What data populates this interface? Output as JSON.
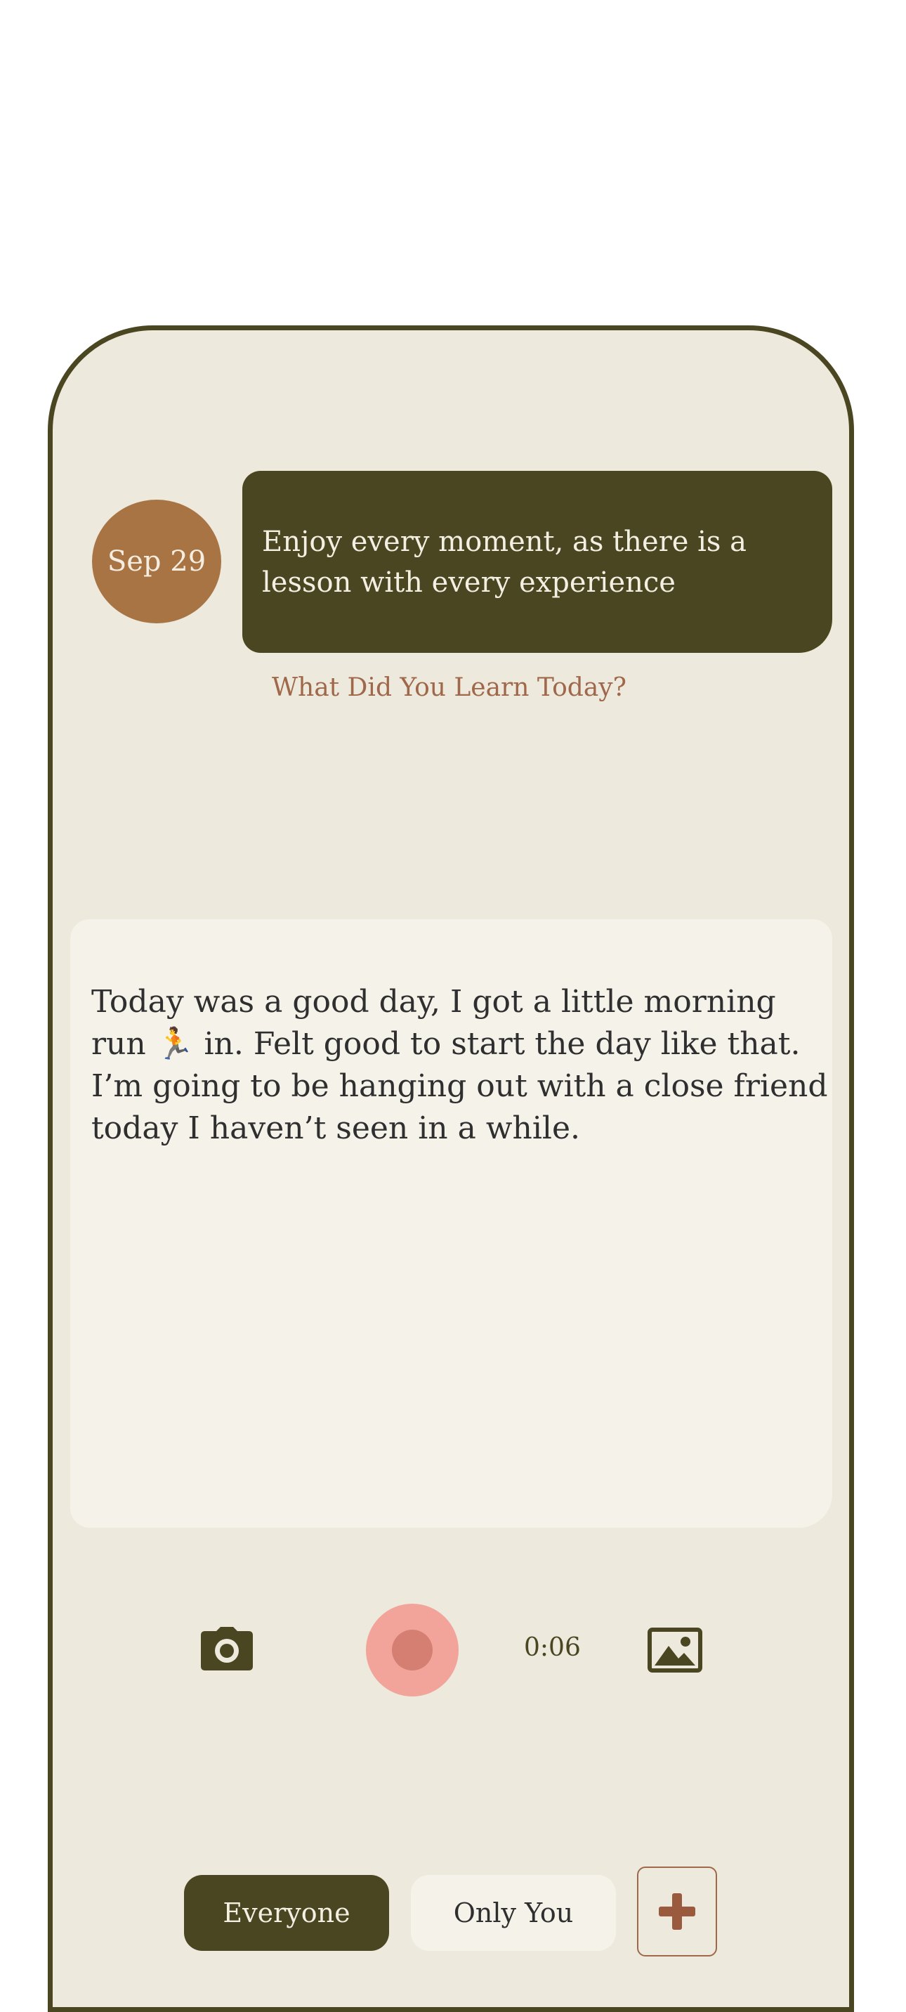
{
  "prompt": {
    "date": "Sep 29",
    "quote": "Enjoy every moment, as there is a lesson with every experience",
    "question": "What Did You Learn Today?"
  },
  "entry": {
    "text": "Today was a good day, I got a little morning run 🏃 in. Felt good to start the day like that. I’m going to be hanging out with a close friend today I haven’t seen in a while."
  },
  "toolbar": {
    "camera_icon": "camera-icon",
    "record_icon": "record-icon",
    "timer": "0:06",
    "gallery_icon": "image-icon"
  },
  "visibility": {
    "options": [
      "Everyone",
      "Only You"
    ],
    "selected": "Everyone",
    "add_icon": "plus-icon"
  },
  "colors": {
    "olive": "#4a4621",
    "background": "#ede9dc",
    "card": "#f5f2ea",
    "accent_brown": "#a87443",
    "question_text": "#a0684a",
    "record_pink": "#f2a39a"
  }
}
